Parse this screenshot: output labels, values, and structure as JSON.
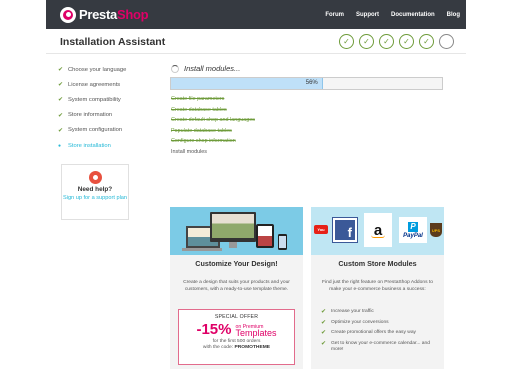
{
  "header": {
    "logo_text_a": "Presta",
    "logo_text_b": "Shop",
    "nav": [
      "Forum",
      "Support",
      "Documentation",
      "Blog"
    ]
  },
  "page_title": "Installation Assistant",
  "step_indicators": [
    {
      "done": true
    },
    {
      "done": true
    },
    {
      "done": true
    },
    {
      "done": true
    },
    {
      "done": true
    },
    {
      "done": false
    }
  ],
  "sidebar": {
    "items": [
      {
        "label": "Choose your language",
        "state": "done"
      },
      {
        "label": "License agreements",
        "state": "done"
      },
      {
        "label": "System compatibility",
        "state": "done"
      },
      {
        "label": "Store information",
        "state": "done"
      },
      {
        "label": "System configuration",
        "state": "done"
      },
      {
        "label": "Store installation",
        "state": "active"
      }
    ]
  },
  "help": {
    "title": "Need help?",
    "link": "Sign up for a support plan"
  },
  "install": {
    "heading": "Install modules...",
    "progress_label": "56%",
    "progress_value": 56,
    "tasks": [
      {
        "label": "Create file parameters",
        "done": true
      },
      {
        "label": "Create database tables",
        "done": true
      },
      {
        "label": "Create default shop and languages",
        "done": true
      },
      {
        "label": "Populate database tables",
        "done": true
      },
      {
        "label": "Configure shop information",
        "done": true
      },
      {
        "label": "Install modules",
        "done": false
      }
    ]
  },
  "design_card": {
    "title": "Customize Your Design!",
    "text": "Create a design that suits your products and your customers, with a ready-to-use template theme.",
    "offer": {
      "heading": "SPECIAL OFFER",
      "percent": "-15%",
      "on": "on Premium",
      "what": "Templates",
      "foot1": "for the first 500 orders",
      "foot2": "with the code:",
      "code": "PROMOTHEME"
    }
  },
  "modules_card": {
    "title": "Custom Store Modules",
    "text": "Find just the right feature on PrestaShop Addons to make your e-commerce business a success:",
    "logos": {
      "youtube": "You",
      "facebook": "f",
      "amazon": "a",
      "paypal_mark": "P",
      "paypal": "PayPal",
      "ups": "UPS"
    },
    "benefits": [
      "Increase your traffic",
      "Optimize your conversions",
      "Create promotional offers the easy way",
      "Get to know your e-commerce calendar... and more!"
    ]
  },
  "colors": {
    "brand": "#df0067",
    "header_bg": "#363a41",
    "done": "#6e9b3a",
    "active": "#25b9d7",
    "progress": "#bfe0f8"
  }
}
